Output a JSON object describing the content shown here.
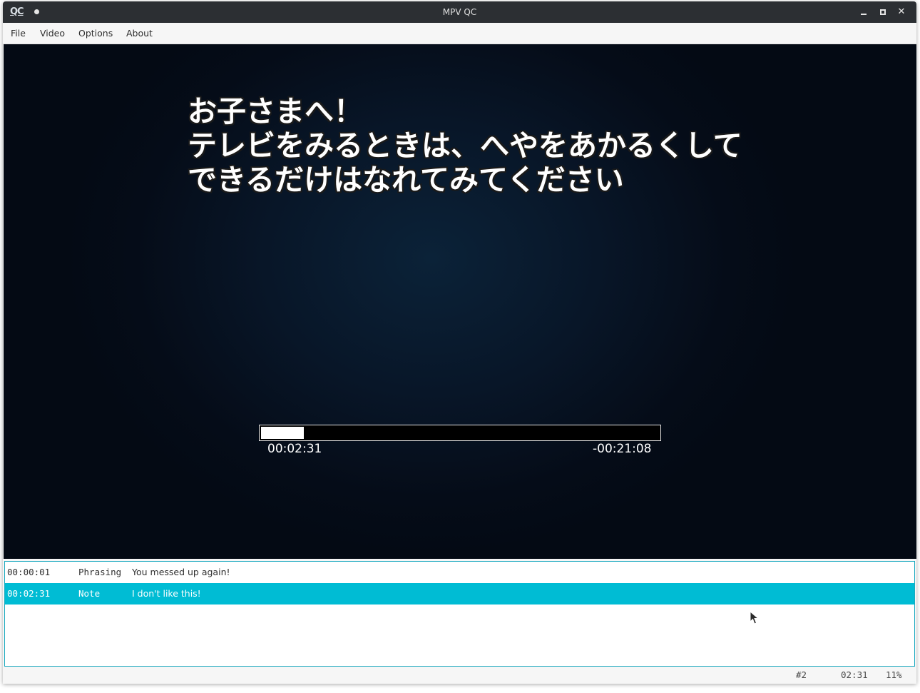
{
  "window": {
    "title": "MPV QC",
    "app_icon_text": "QC"
  },
  "menu": {
    "items": [
      "File",
      "Video",
      "Options",
      "About"
    ]
  },
  "video": {
    "subtitle_lines": [
      "お子さまへ！",
      "テレビをみるときは、へやをあかるくして",
      "できるだけはなれてみてください"
    ],
    "elapsed": "00:02:31",
    "remaining": "-00:21:08",
    "progress": 0.107
  },
  "comments": {
    "rows": [
      {
        "time": "00:00:01",
        "type": "Phrasing",
        "text": "You messed up again!",
        "selected": false
      },
      {
        "time": "00:02:31",
        "type": "Note",
        "text": "I don't like this!",
        "selected": true
      }
    ]
  },
  "status": {
    "row_index": "#2",
    "time": "02:31",
    "percent": "11%"
  },
  "colors": {
    "selection": "#00bcd4",
    "titlebar": "#2c2f33"
  }
}
